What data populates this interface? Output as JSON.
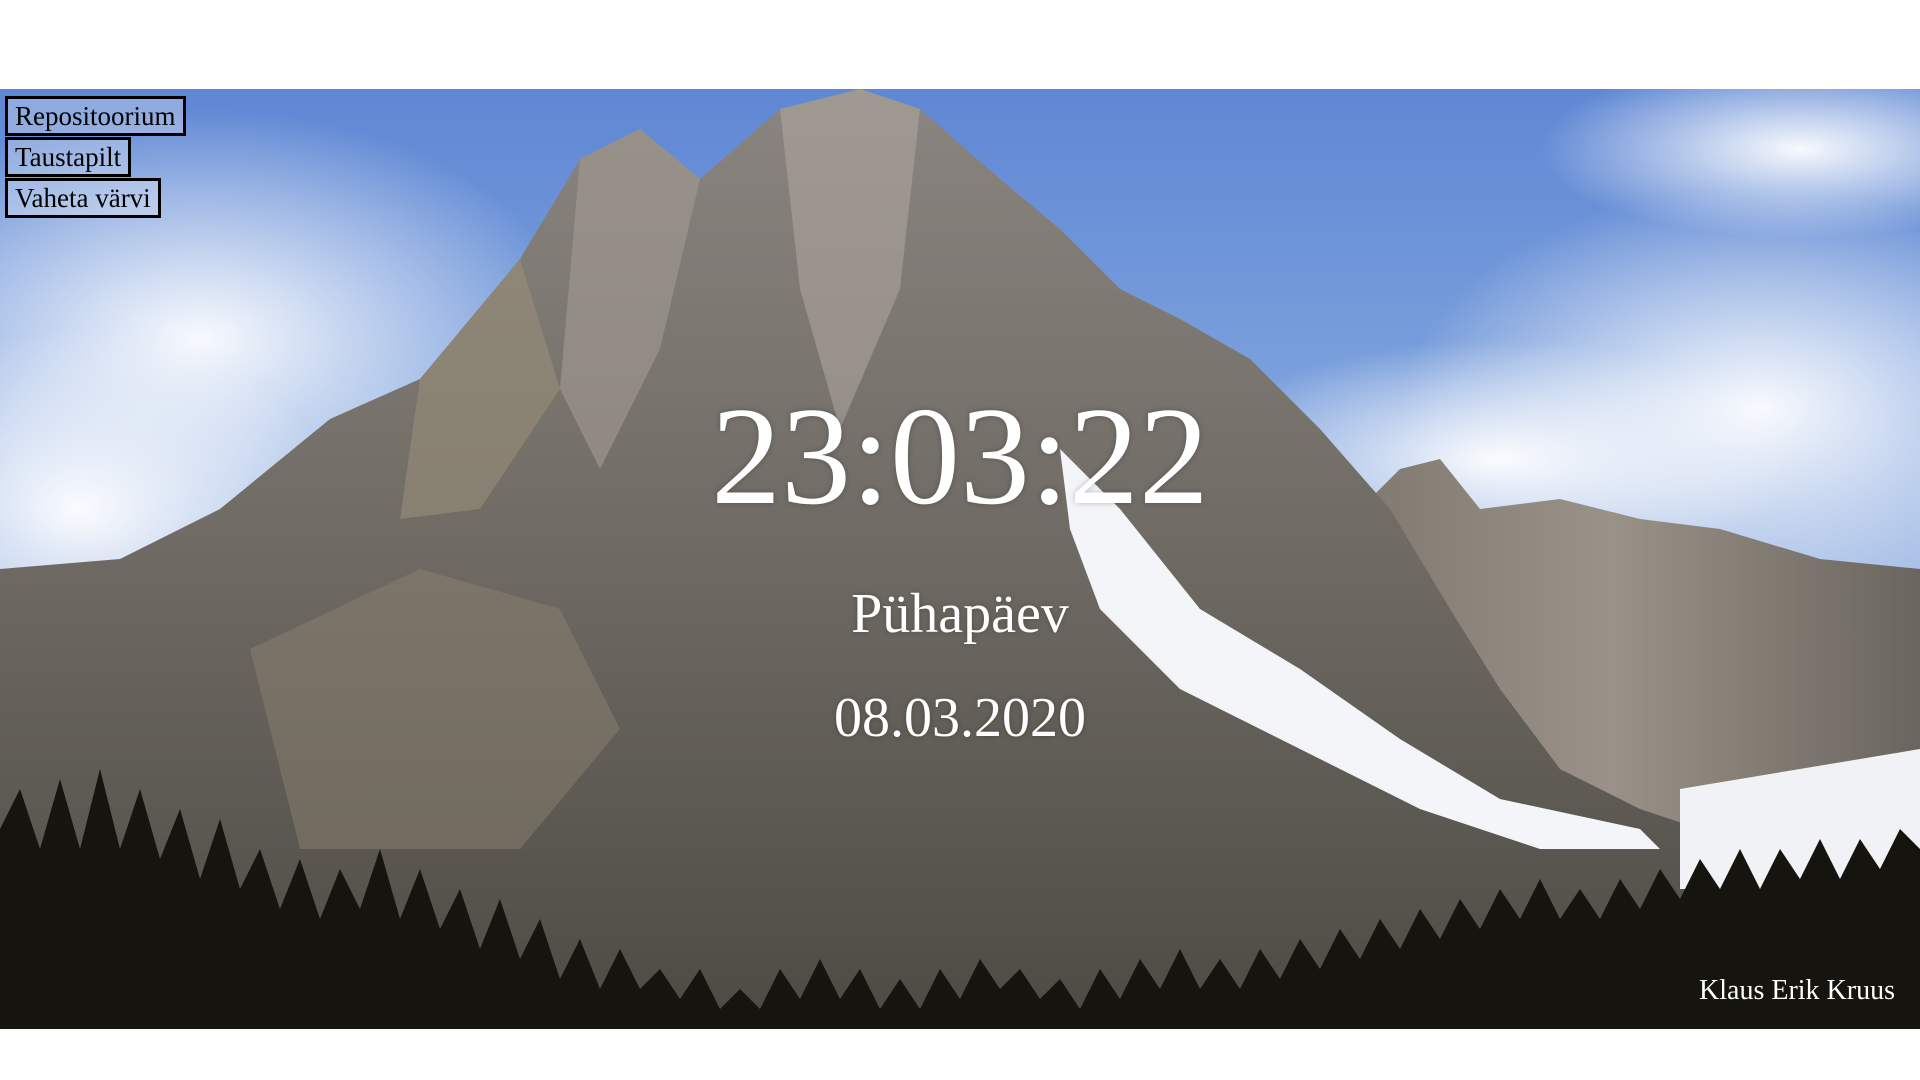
{
  "menu": {
    "repository_label": "Repositoorium",
    "background_label": "Taustapilt",
    "color_label": "Vaheta värvi"
  },
  "clock": {
    "time": "23:03:22",
    "weekday": "Pühapäev",
    "date": "08.03.2020"
  },
  "footer": {
    "author": "Klaus Erik Kruus"
  },
  "colors": {
    "text": "#ffffff",
    "button_border": "#000000",
    "page_background": "#ffffff"
  }
}
